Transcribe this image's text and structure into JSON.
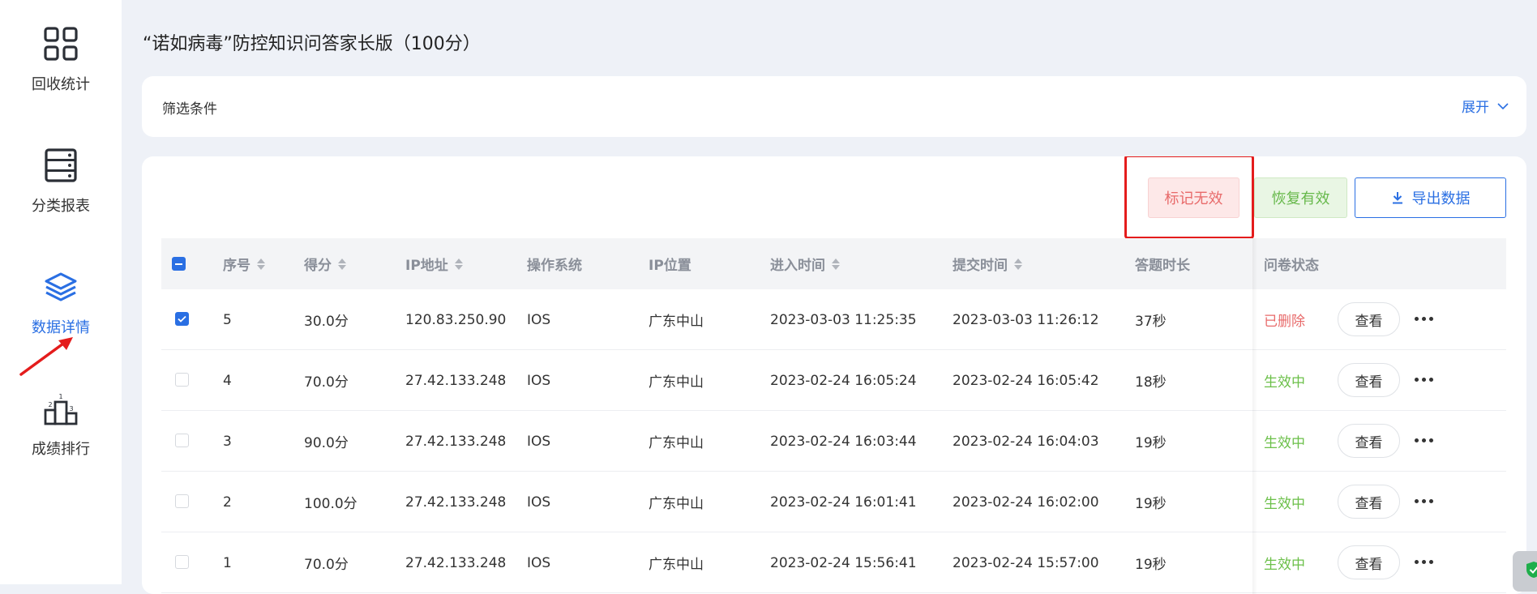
{
  "sidebar": {
    "items": [
      {
        "label": "回收统计",
        "icon": "grid-icon"
      },
      {
        "label": "分类报表",
        "icon": "server-list-icon"
      },
      {
        "label": "数据详情",
        "icon": "layers-icon",
        "active": true
      },
      {
        "label": "成绩排行",
        "icon": "podium-icon"
      }
    ]
  },
  "page": {
    "title": "“诺如病毒”防控知识问答家长版（100分）"
  },
  "filter": {
    "label": "筛选条件",
    "expand_label": "展开"
  },
  "toolbar": {
    "mark_invalid": "标记无效",
    "restore_valid": "恢复有效",
    "export": "导出数据"
  },
  "table": {
    "headers": {
      "index": "序号",
      "score": "得分",
      "ip": "IP地址",
      "os": "操作系统",
      "location": "IP位置",
      "enter_time": "进入时间",
      "submit_time": "提交时间",
      "duration": "答题时长",
      "status": "问卷状态"
    },
    "view_label": "查看",
    "rows": [
      {
        "checked": true,
        "index": "5",
        "score": "30.0分",
        "ip": "120.83.250.90",
        "os": "IOS",
        "location": "广东中山",
        "enter_time": "2023-03-03 11:25:35",
        "submit_time": "2023-03-03 11:26:12",
        "duration": "37秒",
        "status": "已删除",
        "status_type": "deleted"
      },
      {
        "checked": false,
        "index": "4",
        "score": "70.0分",
        "ip": "27.42.133.248",
        "os": "IOS",
        "location": "广东中山",
        "enter_time": "2023-02-24 16:05:24",
        "submit_time": "2023-02-24 16:05:42",
        "duration": "18秒",
        "status": "生效中",
        "status_type": "active"
      },
      {
        "checked": false,
        "index": "3",
        "score": "90.0分",
        "ip": "27.42.133.248",
        "os": "IOS",
        "location": "广东中山",
        "enter_time": "2023-02-24 16:03:44",
        "submit_time": "2023-02-24 16:04:03",
        "duration": "19秒",
        "status": "生效中",
        "status_type": "active"
      },
      {
        "checked": false,
        "index": "2",
        "score": "100.0分",
        "ip": "27.42.133.248",
        "os": "IOS",
        "location": "广东中山",
        "enter_time": "2023-02-24 16:01:41",
        "submit_time": "2023-02-24 16:02:00",
        "duration": "19秒",
        "status": "生效中",
        "status_type": "active"
      },
      {
        "checked": false,
        "index": "1",
        "score": "70.0分",
        "ip": "27.42.133.248",
        "os": "IOS",
        "location": "广东中山",
        "enter_time": "2023-02-24 15:56:41",
        "submit_time": "2023-02-24 15:57:00",
        "duration": "19秒",
        "status": "生效中",
        "status_type": "active"
      }
    ]
  },
  "colors": {
    "accent": "#2a6fe3",
    "deleted": "#e86a6a",
    "active": "#6cc04a",
    "annotation": "#e41c1c"
  }
}
